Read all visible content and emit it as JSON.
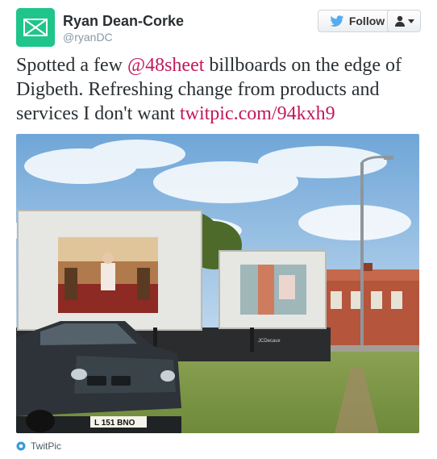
{
  "user": {
    "name": "Ryan Dean-Corke",
    "handle": "@ryanDC"
  },
  "buttons": {
    "follow_label": "Follow",
    "follow_icon": "twitter-bird-icon",
    "user_menu_icon": "user-icon"
  },
  "tweet": {
    "text_before": "Spotted a few ",
    "mention": "@48sheet",
    "text_middle": " billboards on the edge of Digbeth. Refreshing change from products and services I don't want ",
    "link": "twitpic.com/94kxh9"
  },
  "photo": {
    "billboard_brand": "JCDecaux",
    "license_plate": "L 151 BNO"
  },
  "footer": {
    "source": "TwitPic",
    "source_icon": "twitpic-icon"
  },
  "colors": {
    "link": "#c2185b",
    "avatar": "#1fc58a",
    "bird": "#55acee"
  }
}
